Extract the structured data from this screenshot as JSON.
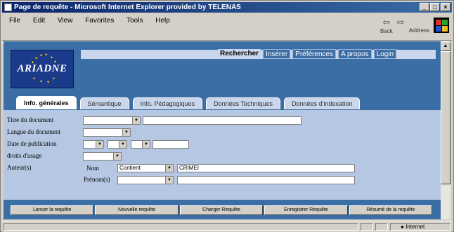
{
  "window": {
    "title": "Page de requête - Microsoft Internet Explorer provided by TELENAS",
    "min": "_",
    "max": "□",
    "close": "×"
  },
  "menu": [
    "File",
    "Edit",
    "View",
    "Favorites",
    "Tools",
    "Help"
  ],
  "toolbar": {
    "back": "Back",
    "address": "Address"
  },
  "logo": {
    "text": "ARIADNE"
  },
  "nav": [
    "Rechercher",
    "Insérer",
    "Préférences",
    "A propos",
    "Login"
  ],
  "tabs": [
    "Info. générales",
    "Sémantique",
    "Info. Pédagogiques",
    "Données Techniques",
    "Données d'indexation"
  ],
  "form": {
    "title_label": "Titre du document",
    "lang_label": "Langue du document",
    "date_label": "Date de publication",
    "rights_label": "droits d'usage",
    "author_label": "Auteur(s)",
    "name_label": "Nom",
    "first_label": "Prénom(s)",
    "name_mode": "Contient",
    "name_value": "CRIMEI"
  },
  "buttons": [
    "Lancer la requête",
    "Nouvelle requête",
    "Charger Requête",
    "Enregistrer Requête",
    "Résumé de la requête"
  ],
  "status": {
    "zone": "Internet"
  }
}
